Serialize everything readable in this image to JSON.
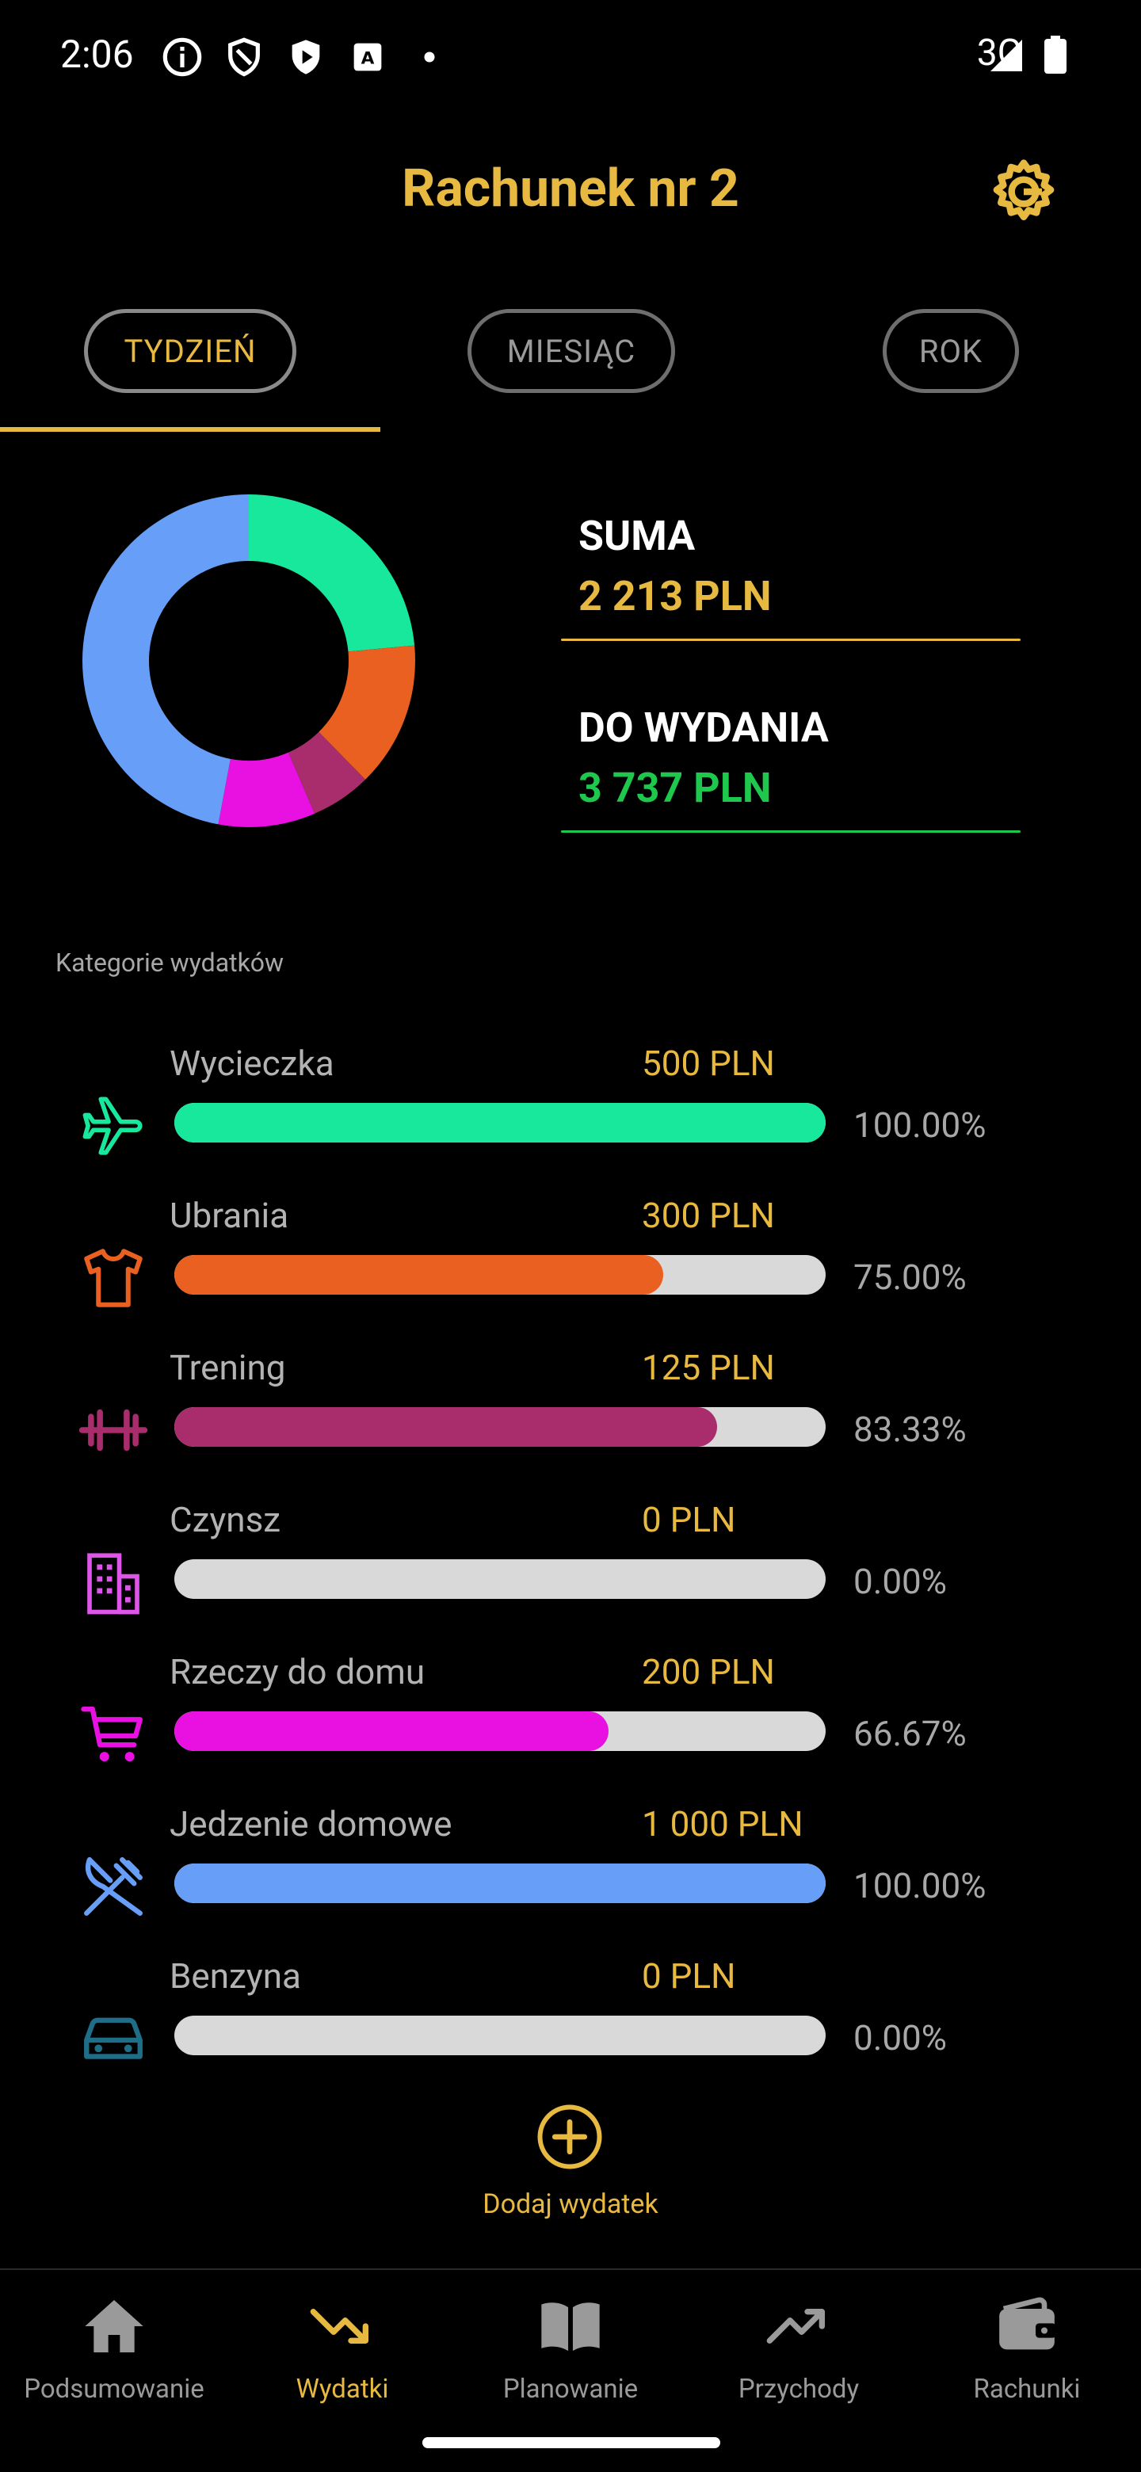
{
  "status_bar": {
    "time": "2:06",
    "network": "3G"
  },
  "header": {
    "title": "Rachunek nr 2"
  },
  "tabs": [
    {
      "label": "TYDZIEŃ",
      "active": true
    },
    {
      "label": "MIESIĄC",
      "active": false
    },
    {
      "label": "ROK",
      "active": false
    }
  ],
  "summary": {
    "sum_label": "SUMA",
    "sum_value": "2 213 PLN",
    "remaining_label": "DO WYDANIA",
    "remaining_value": "3 737 PLN"
  },
  "chart_data": {
    "type": "pie",
    "categories": [
      "Wycieczka",
      "Ubrania",
      "Trening",
      "Czynsz",
      "Rzeczy do domu",
      "Jedzenie domowe",
      "Benzyna"
    ],
    "values": [
      500,
      300,
      125,
      0,
      200,
      1000,
      0
    ],
    "colors": [
      "#17e89b",
      "#ea6020",
      "#a92d6c",
      "#de55ea",
      "#e911e2",
      "#679ff8",
      "#a9ff6f"
    ],
    "donut": true
  },
  "section_label": "Kategorie wydatków",
  "categories": [
    {
      "name": "Wycieczka",
      "amount": "500 PLN",
      "percent": "100.00%",
      "fill": 1.0,
      "color": "#17e89b",
      "icon": "airplane-icon"
    },
    {
      "name": "Ubrania",
      "amount": "300 PLN",
      "percent": "75.00%",
      "fill": 0.75,
      "color": "#ea6020",
      "icon": "tshirt-icon"
    },
    {
      "name": "Trening",
      "amount": "125 PLN",
      "percent": "83.33%",
      "fill": 0.8333,
      "color": "#a92d6c",
      "icon": "dumbbell-icon"
    },
    {
      "name": "Czynsz",
      "amount": "0 PLN",
      "percent": "0.00%",
      "fill": 0.0,
      "color": "#de55ea",
      "icon": "building-icon"
    },
    {
      "name": "Rzeczy do domu",
      "amount": "200 PLN",
      "percent": "66.67%",
      "fill": 0.6667,
      "color": "#e911e2",
      "icon": "cart-icon"
    },
    {
      "name": "Jedzenie domowe",
      "amount": "1 000 PLN",
      "percent": "100.00%",
      "fill": 1.0,
      "color": "#679ff8",
      "icon": "cutlery-icon"
    },
    {
      "name": "Benzyna",
      "amount": "0 PLN",
      "percent": "0.00%",
      "fill": 0.0,
      "color": "#1e6e87",
      "icon": "car-icon"
    }
  ],
  "add_expense": {
    "label": "Dodaj wydatek"
  },
  "bottom_nav": [
    {
      "label": "Podsumowanie",
      "icon": "home-icon",
      "active": false
    },
    {
      "label": "Wydatki",
      "icon": "trending-down-icon",
      "active": true
    },
    {
      "label": "Planowanie",
      "icon": "book-icon",
      "active": false
    },
    {
      "label": "Przychody",
      "icon": "trending-up-icon",
      "active": false
    },
    {
      "label": "Rachunki",
      "icon": "wallet-icon",
      "active": false
    }
  ],
  "colors": {
    "accent": "#e8b941",
    "remaining": "#1ec84c"
  }
}
